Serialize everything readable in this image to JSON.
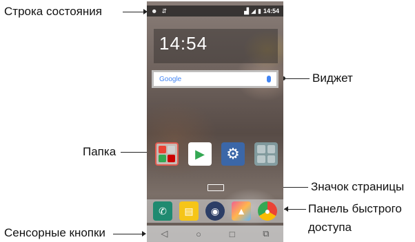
{
  "callouts": {
    "status_bar": "Строка состояния",
    "widget": "Виджет",
    "folder": "Папка",
    "page_indicator": "Значок страницы",
    "quick_access_line1": "Панель быстрого",
    "quick_access_line2": "доступа",
    "touch_buttons": "Сенсорные кнопки"
  },
  "phone": {
    "status_time": "14:54",
    "clock_time": "14:54",
    "search_brand": "Google",
    "colors": {
      "folder_border": "#e05a4f",
      "settings": "#3b67a8",
      "phone_app": "#1f8a70",
      "messages": "#f5c518"
    },
    "icons": {
      "folder": "folder-icon",
      "store": "play-store-icon",
      "settings": "gear-icon",
      "tiles": "tiles-app-icon",
      "phone": "phone-icon",
      "messages": "messages-icon",
      "camera": "camera-icon",
      "gallery": "gallery-icon",
      "chrome": "chrome-icon",
      "back": "back-icon",
      "home": "home-icon",
      "recent": "recent-apps-icon",
      "dual_window": "dual-window-icon"
    }
  }
}
